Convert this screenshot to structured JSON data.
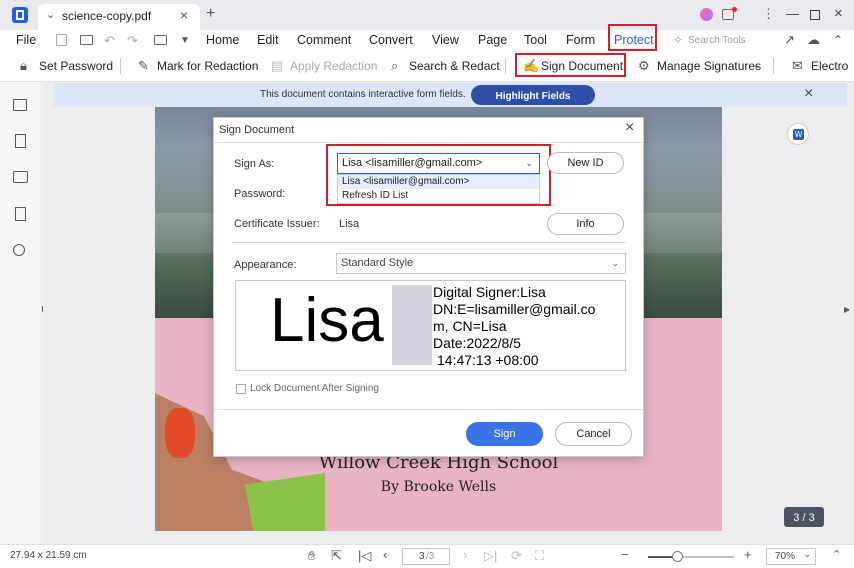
{
  "titlebar": {
    "tab_title": "science-copy.pdf"
  },
  "menu": {
    "file": "File",
    "items": [
      "Home",
      "Edit",
      "Comment",
      "Convert",
      "View",
      "Page",
      "Tool",
      "Form",
      "Protect"
    ],
    "search_placeholder": "Search Tools"
  },
  "toolbar": {
    "set_password": "Set Password",
    "mark_redaction": "Mark for Redaction",
    "apply_redaction": "Apply Redaction",
    "search_redact": "Search & Redact",
    "sign_document": "Sign Document",
    "manage_signatures": "Manage Signatures",
    "electronic": "Electro"
  },
  "notice": {
    "text": "This document contains interactive form fields.",
    "button": "Highlight Fields"
  },
  "document": {
    "school": "Willow Creek High School",
    "author": "By Brooke Wells",
    "page_badge": "3 / 3"
  },
  "dialog": {
    "title": "Sign Document",
    "sign_as_label": "Sign As:",
    "sign_as_value": "Lisa <lisamiller@gmail.com>",
    "dropdown_options": [
      "Lisa <lisamiller@gmail.com>",
      "Refresh ID List"
    ],
    "new_id": "New ID",
    "password_label": "Password:",
    "issuer_label": "Certificate Issuer:",
    "issuer_value": "Lisa",
    "info": "Info",
    "appearance_label": "Appearance:",
    "appearance_value": "Standard Style",
    "preview_name": "Lisa",
    "preview_lines": [
      "Digital Signer:Lisa",
      "DN:E=lisamiller@gmail.co",
      "m, CN=Lisa",
      "Date:2022/8/5",
      "14:47:13 +08:00"
    ],
    "lock_label": "Lock Document After Signing",
    "sign_btn": "Sign",
    "cancel_btn": "Cancel"
  },
  "status": {
    "dimensions": "27.94 x 21.59 cm",
    "page_input": "3",
    "page_total": "/3",
    "zoom": "70%"
  },
  "colors": {
    "accent": "#2f5fd6",
    "red_highlight": "#d3202a"
  }
}
